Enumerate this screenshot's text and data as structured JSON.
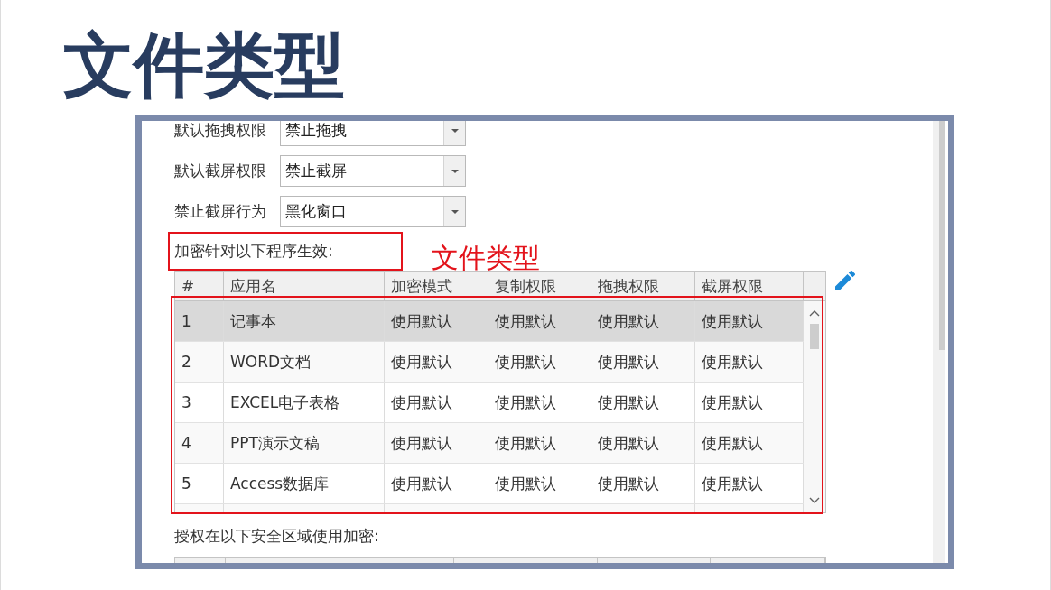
{
  "slide": {
    "title": "文件类型"
  },
  "settings": [
    {
      "label": "默认拖拽权限",
      "value": "禁止拖拽"
    },
    {
      "label": "默认截屏权限",
      "value": "禁止截屏"
    },
    {
      "label": "禁止截屏行为",
      "value": "黑化窗口"
    }
  ],
  "programs": {
    "label": "加密针对以下程序生效:",
    "annotation": "文件类型",
    "table": {
      "columns": [
        "#",
        "应用名",
        "加密模式",
        "复制权限",
        "拖拽权限",
        "截屏权限"
      ],
      "rows": [
        {
          "cells": [
            "1",
            "记事本",
            "使用默认",
            "使用默认",
            "使用默认",
            "使用默认"
          ],
          "selected": true
        },
        {
          "cells": [
            "2",
            "WORD文档",
            "使用默认",
            "使用默认",
            "使用默认",
            "使用默认"
          ],
          "selected": false
        },
        {
          "cells": [
            "3",
            "EXCEL电子表格",
            "使用默认",
            "使用默认",
            "使用默认",
            "使用默认"
          ],
          "selected": false
        },
        {
          "cells": [
            "4",
            "PPT演示文稿",
            "使用默认",
            "使用默认",
            "使用默认",
            "使用默认"
          ],
          "selected": false
        },
        {
          "cells": [
            "5",
            "Access数据库",
            "使用默认",
            "使用默认",
            "使用默认",
            "使用默认"
          ],
          "selected": false
        }
      ]
    }
  },
  "zones": {
    "label": "授权在以下安全区域使用加密:"
  }
}
